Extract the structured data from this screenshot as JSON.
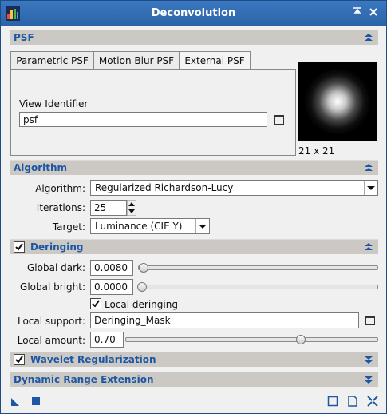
{
  "window": {
    "title": "Deconvolution"
  },
  "psf_section": {
    "title": "PSF",
    "tabs": [
      "Parametric PSF",
      "Motion Blur PSF",
      "External PSF"
    ],
    "active_tab": "External PSF",
    "view_identifier_label": "View Identifier",
    "view_identifier_value": "psf",
    "psf_size": "21 x 21"
  },
  "algorithm_section": {
    "title": "Algorithm",
    "algorithm_label": "Algorithm:",
    "algorithm_value": "Regularized Richardson-Lucy",
    "iterations_label": "Iterations:",
    "iterations_value": "25",
    "target_label": "Target:",
    "target_value": "Luminance (CIE Y)"
  },
  "deringing_section": {
    "title": "Deringing",
    "checked": true,
    "global_dark_label": "Global dark:",
    "global_dark_value": "0.0080",
    "global_dark_level": 0.008,
    "global_bright_label": "Global bright:",
    "global_bright_value": "0.0000",
    "global_bright_level": 0.0,
    "local_deringing_label": "Local deringing",
    "local_deringing_checked": true,
    "local_support_label": "Local support:",
    "local_support_value": "Deringing_Mask",
    "local_amount_label": "Local amount:",
    "local_amount_value": "0.70",
    "local_amount_level": 0.7
  },
  "wavelet_section": {
    "title": "Wavelet Regularization",
    "checked": true
  },
  "dynamic_range_section": {
    "title": "Dynamic Range Extension"
  },
  "colors": {
    "section_title": "#1d57a3",
    "titlebar": "#2b63a8"
  }
}
